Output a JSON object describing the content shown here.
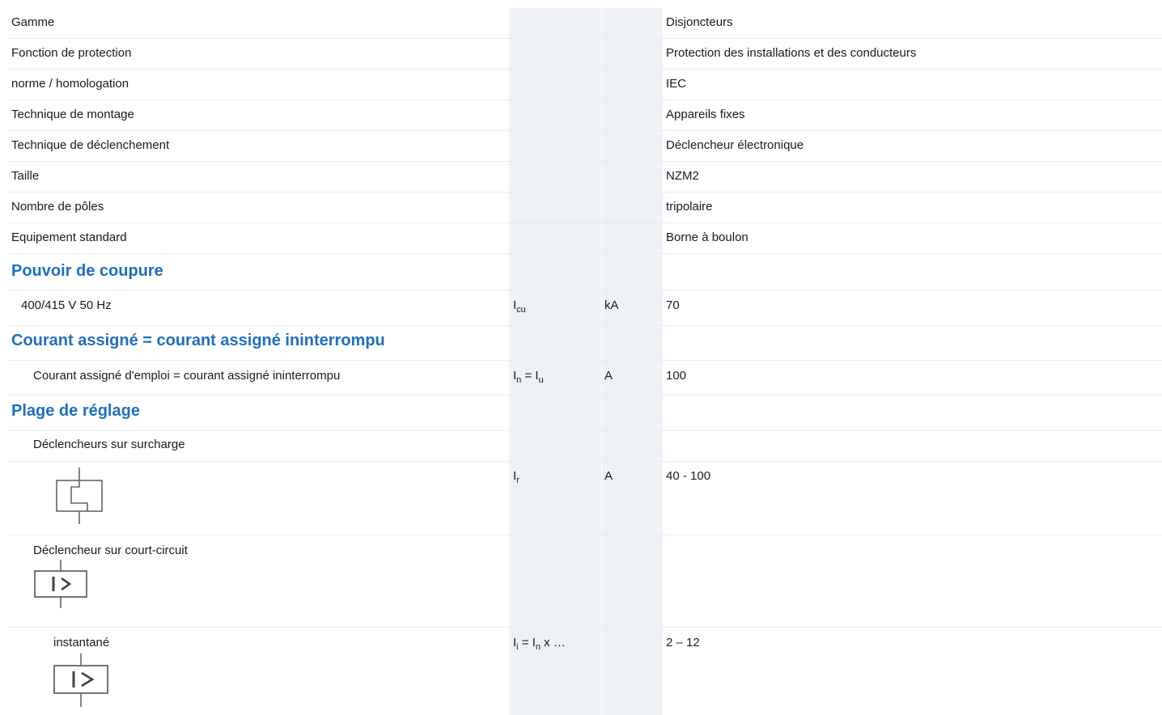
{
  "rows": [
    {
      "label": "Gamme",
      "value": "Disjoncteurs"
    },
    {
      "label": "Fonction de protection",
      "value": "Protection des installations et des conducteurs"
    },
    {
      "label": "norme / homologation",
      "value": "IEC"
    },
    {
      "label": "Technique de montage",
      "value": "Appareils fixes"
    },
    {
      "label": "Technique de déclenchement",
      "value": "Déclencheur électronique"
    },
    {
      "label": "Taille",
      "value": "NZM2"
    },
    {
      "label": "Nombre de pôles",
      "value": "tripolaire"
    },
    {
      "label": "Equipement standard",
      "value": "Borne à boulon"
    }
  ],
  "sections": {
    "breaking": {
      "title": "Pouvoir de coupure",
      "row": {
        "label": "400/415 V 50 Hz",
        "sym_main": "I",
        "sym_sub": "cu",
        "unit": "kA",
        "value": "70"
      }
    },
    "current": {
      "title": "Courant assigné = courant assigné ininterrompu",
      "row": {
        "label": "Courant assigné d'emploi = courant assigné ininterrompu",
        "sym_a": "I",
        "sym_a_sub": "n",
        "sym_eq": " = I",
        "sym_b_sub": "u",
        "unit": "A",
        "value": "100"
      }
    },
    "setting": {
      "title": "Plage de réglage",
      "overload_label": "Déclencheurs sur surcharge",
      "overload_row": {
        "sym_main": "I",
        "sym_sub": "r",
        "unit": "A",
        "value": "40 - 100"
      },
      "short_label": "Déclencheur sur court-circuit",
      "instant_row": {
        "label": "instantané",
        "sym_a": "I",
        "sym_a_sub": "i",
        "sym_eq": " = I",
        "sym_b_sub": "n",
        "sym_tail": " x …",
        "value": "2 – 12"
      }
    }
  },
  "icons": {
    "overload": "thermal-trip-icon",
    "short_circuit": "magnetic-trip-icon",
    "instantaneous": "instantaneous-trip-icon"
  }
}
